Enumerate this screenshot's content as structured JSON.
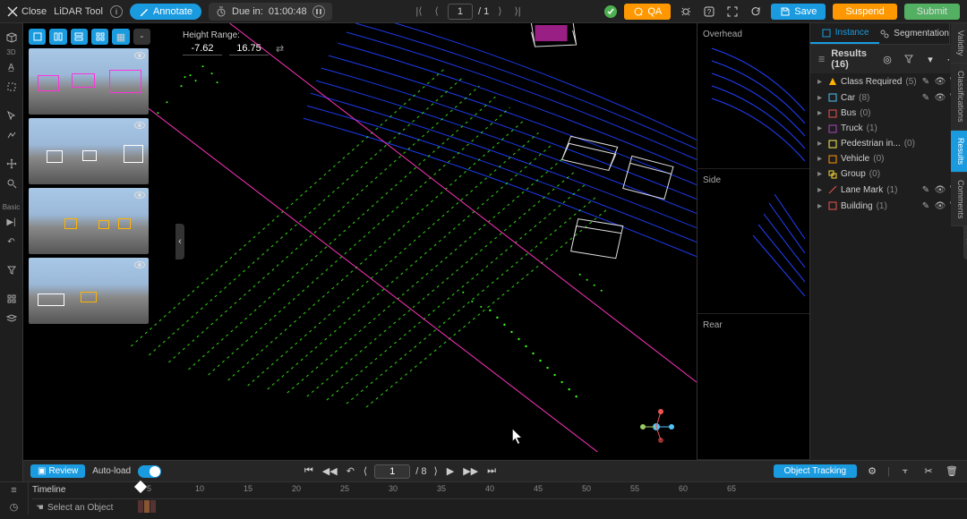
{
  "topbar": {
    "close": "Close",
    "tool": "LiDAR Tool",
    "annotate": "Annotate",
    "due_prefix": "Due in:",
    "due_time": "01:00:48",
    "page_current": "1",
    "page_total": "/ 1",
    "qa": "QA",
    "save": "Save",
    "suspend": "Suspend",
    "submit": "Submit"
  },
  "left_tools": {
    "t3d": "3D"
  },
  "basic_label": "Basic",
  "height_range": {
    "label": "Height Range:",
    "min": "-7.62",
    "max": "16.75"
  },
  "sideviews": {
    "overhead": "Overhead",
    "side": "Side",
    "rear": "Rear"
  },
  "results": {
    "tab_instance": "Instance",
    "tab_segmentation": "Segmentation",
    "header": "Results (16)",
    "items": [
      {
        "icon": "warn",
        "color": "#ffb300",
        "name": "Class Required",
        "count": "(5)",
        "actions": true
      },
      {
        "icon": "box",
        "color": "#4fc3f7",
        "name": "Car",
        "count": "(8)",
        "actions": true
      },
      {
        "icon": "box",
        "color": "#ef5350",
        "name": "Bus",
        "count": "(0)",
        "actions": false
      },
      {
        "icon": "box",
        "color": "#ab47bc",
        "name": "Truck",
        "count": "(1)",
        "actions": false
      },
      {
        "icon": "box",
        "color": "#ffee58",
        "name": "Pedestrian in...",
        "count": "(0)",
        "actions": false
      },
      {
        "icon": "box",
        "color": "#ff9800",
        "name": "Vehicle",
        "count": "(0)",
        "actions": false
      },
      {
        "icon": "grp",
        "color": "#fdd835",
        "name": "Group",
        "count": "(0)",
        "actions": false
      },
      {
        "icon": "line",
        "color": "#ef5350",
        "name": "Lane Mark",
        "count": "(1)",
        "actions": true
      },
      {
        "icon": "box",
        "color": "#ef5350",
        "name": "Building",
        "count": "(1)",
        "actions": true
      }
    ]
  },
  "right_strip": {
    "validity": "Validity",
    "results": "Results",
    "classifications": "Classifications",
    "comments": "Comments"
  },
  "playbar": {
    "review": "Review",
    "auto_load": "Auto-load",
    "frame": "1",
    "frames_total": "/ 8",
    "object_tracking": "Object Tracking"
  },
  "timeline": {
    "label": "Timeline",
    "select": "Select an Object",
    "ticks": [
      "5",
      "10",
      "15",
      "20",
      "25",
      "30",
      "35",
      "40",
      "45",
      "50",
      "55",
      "60",
      "65"
    ]
  }
}
